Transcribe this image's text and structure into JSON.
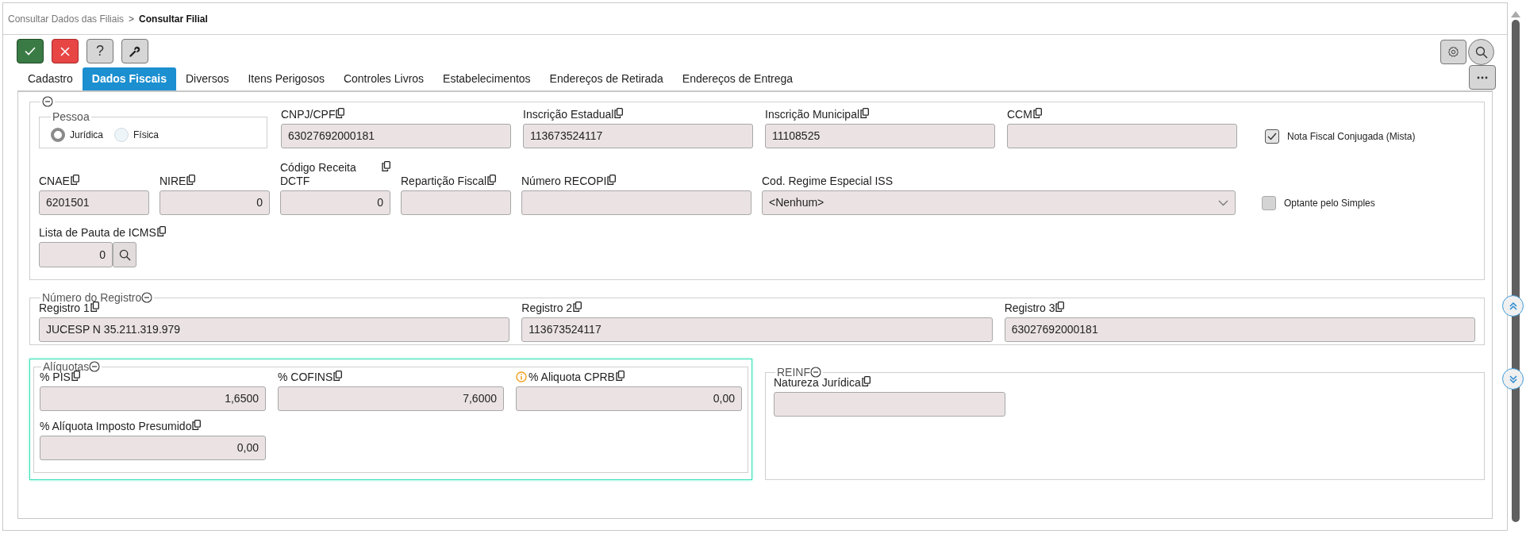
{
  "breadcrumb": [
    {
      "label": "Consultar Dados das Filiais",
      "current": false
    },
    {
      "label": "Consultar Filial",
      "current": true
    }
  ],
  "breadcrumb_separator": ">",
  "toolbar": [
    {
      "kind": "confirm"
    },
    {
      "kind": "cancel"
    },
    {
      "kind": "help",
      "label": "?"
    },
    {
      "kind": "tools"
    }
  ],
  "right_tools": [
    {
      "kind": "settings"
    },
    {
      "kind": "search"
    }
  ],
  "tabs": [
    {
      "label": "Cadastro",
      "selected": false
    },
    {
      "label": "Dados Fiscais",
      "selected": true
    },
    {
      "label": "Diversos",
      "selected": false
    },
    {
      "label": "Itens Perigosos",
      "selected": false
    },
    {
      "label": "Controles Livros",
      "selected": false
    },
    {
      "label": "Estabelecimentos",
      "selected": false
    },
    {
      "label": "Endereços de Retirada",
      "selected": false
    },
    {
      "label": "Endereços de Entrega",
      "selected": false
    }
  ],
  "fiscal_section": {
    "fields": [
      {
        "kind": "radio_group",
        "legend": "Pessoa",
        "options": [
          {
            "label": "Jurídica",
            "selected": true
          },
          {
            "label": "Física",
            "selected": false
          }
        ]
      },
      {
        "kind": "text",
        "label": "CNPJ/CPF",
        "copyable": true,
        "value": "63027692000181"
      },
      {
        "kind": "text",
        "label": "Inscrição Estadual",
        "copyable": true,
        "value": "113673524117"
      },
      {
        "kind": "text",
        "label": "Inscrição Municipal",
        "copyable": true,
        "value": "11108525"
      },
      {
        "kind": "text",
        "label": "CCM",
        "copyable": true
      },
      {
        "kind": "checkbox",
        "label": "Nota Fiscal Conjugada (Mista)",
        "checked": true
      },
      {
        "kind": "text",
        "label": "CNAE",
        "copyable": true,
        "value": "6201501"
      },
      {
        "kind": "number",
        "label": "NIRE",
        "copyable": true,
        "value": "0"
      },
      {
        "kind": "number",
        "label": "Código Receita DCTF",
        "copyable": true,
        "value": "0"
      },
      {
        "kind": "text",
        "label": "Repartição Fiscal",
        "copyable": true
      },
      {
        "kind": "text",
        "label": "Número RECOPI",
        "copyable": true
      },
      {
        "kind": "select",
        "label": "Cod. Regime Especial ISS",
        "copyable": false,
        "value": "<Nenhum>"
      },
      {
        "kind": "checkbox",
        "label": "Optante pelo Simples",
        "checked": false
      },
      {
        "kind": "lookup",
        "label": "Lista de Pauta de ICMS",
        "copyable": true,
        "value": "0"
      }
    ]
  },
  "registro_section": {
    "legend": "Número do Registro",
    "fields": [
      {
        "kind": "text",
        "label": "Registro 1",
        "copyable": true,
        "value": "JUCESP N 35.211.319.979"
      },
      {
        "kind": "text",
        "label": "Registro 2",
        "copyable": true,
        "value": "113673524117"
      },
      {
        "kind": "text",
        "label": "Registro 3",
        "copyable": true,
        "value": "63027692000181"
      }
    ]
  },
  "aliquotas_section": {
    "legend": "Alíquotas",
    "fields": [
      {
        "kind": "number",
        "label": "% PIS",
        "copyable": true,
        "value": "1,6500"
      },
      {
        "kind": "number",
        "label": "% COFINS",
        "copyable": true,
        "value": "7,6000"
      },
      {
        "kind": "number",
        "label": "% Aliquota CPRB",
        "copyable": true,
        "info": true,
        "value": "0,00"
      },
      {
        "kind": "number",
        "label": "% Alíquota Imposto Presumido",
        "copyable": true,
        "value": "0,00"
      }
    ]
  },
  "reinf_section": {
    "legend": "REINF",
    "fields": [
      {
        "kind": "text",
        "label": "Natureza Jurídica",
        "copyable": true
      }
    ]
  }
}
